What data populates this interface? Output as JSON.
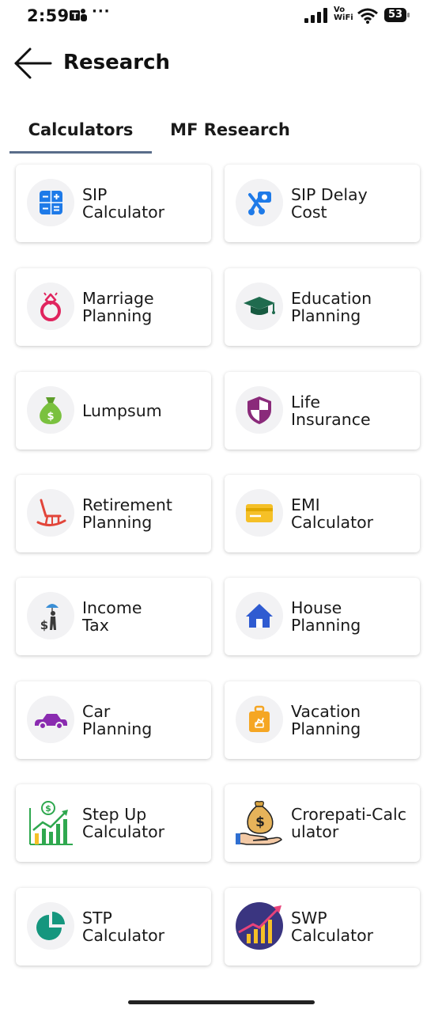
{
  "status_bar": {
    "time": "2:59",
    "more": "···",
    "network_label_top": "Vo",
    "network_label_bottom": "WiFi",
    "battery": "53"
  },
  "header": {
    "title": "Research"
  },
  "tabs": [
    {
      "label": "Calculators",
      "active": true
    },
    {
      "label": "MF Research",
      "active": false
    }
  ],
  "cards": [
    {
      "label_line1": "SIP",
      "label_line2": "Calculator",
      "icon": "calculator-icon",
      "color": "#1e7ae8"
    },
    {
      "label_line1": "SIP Delay",
      "label_line2": "Cost",
      "icon": "delay-icon",
      "color": "#1e7ae8"
    },
    {
      "label_line1": "Marriage",
      "label_line2": "Planning",
      "icon": "ring-icon",
      "color": "#e0245e"
    },
    {
      "label_line1": "Education",
      "label_line2": "Planning",
      "icon": "graduation-cap-icon",
      "color": "#1f6b4e"
    },
    {
      "label_line1": "Lumpsum",
      "label_line2": "",
      "icon": "money-bag-icon",
      "color": "#7ac13f"
    },
    {
      "label_line1": "Life",
      "label_line2": "Insurance",
      "icon": "shield-icon",
      "color": "#8a2a7a"
    },
    {
      "label_line1": "Retirement",
      "label_line2": "Planning",
      "icon": "rocking-chair-icon",
      "color": "#e2453a"
    },
    {
      "label_line1": "EMI",
      "label_line2": "Calculator",
      "icon": "card-icon",
      "color": "#f5c027"
    },
    {
      "label_line1": "Income",
      "label_line2": "Tax",
      "icon": "income-tax-icon",
      "color": "#3a8fd6"
    },
    {
      "label_line1": "House",
      "label_line2": "Planning",
      "icon": "house-icon",
      "color": "#2f5bd1"
    },
    {
      "label_line1": "Car",
      "label_line2": "Planning",
      "icon": "car-icon",
      "color": "#8a2bb0"
    },
    {
      "label_line1": "Vacation",
      "label_line2": "Planning",
      "icon": "suitcase-icon",
      "color": "#f5a623"
    },
    {
      "label_line1": "Step Up",
      "label_line2": "Calculator",
      "icon": "growth-chart-icon",
      "color": "#2fa84f"
    },
    {
      "label_line1": "Crorepati-Calc",
      "label_line2": "ulator",
      "icon": "hand-money-bag-icon",
      "color": "#d9a441"
    },
    {
      "label_line1": "STP",
      "label_line2": "Calculator",
      "icon": "pie-chart-icon",
      "color": "#15967e"
    },
    {
      "label_line1": "SWP",
      "label_line2": "Calculator",
      "icon": "bar-growth-icon",
      "color": "#3a3580"
    }
  ]
}
